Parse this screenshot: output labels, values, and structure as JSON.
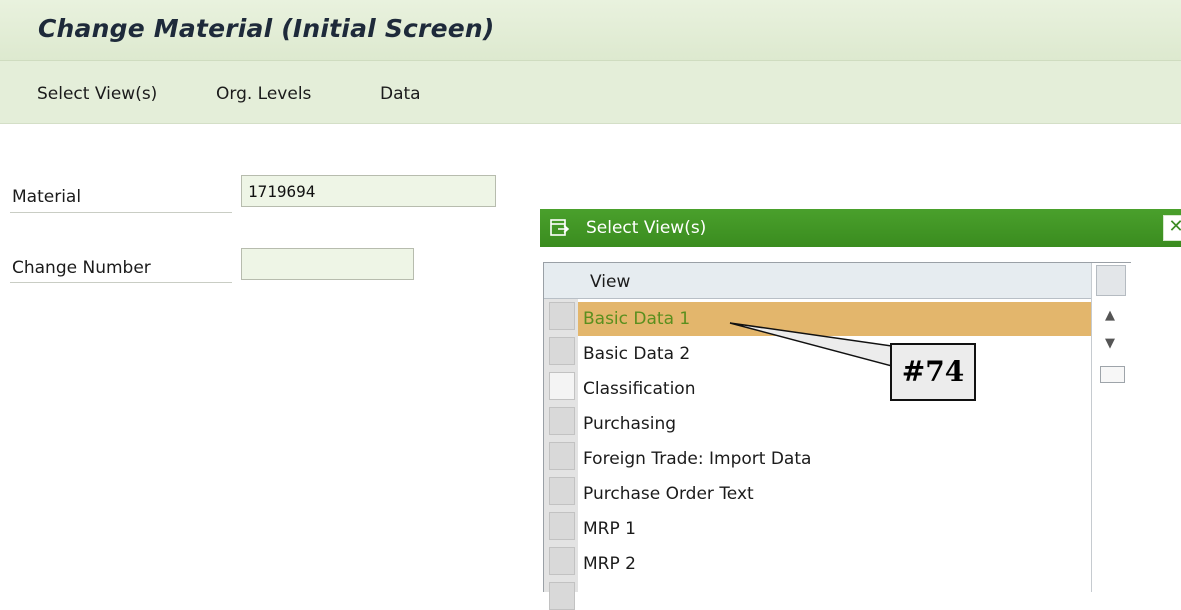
{
  "window": {
    "title": "Change Material (Initial Screen)"
  },
  "menu": {
    "items": [
      "Select View(s)",
      "Org. Levels",
      "Data"
    ]
  },
  "form": {
    "material": {
      "label": "Material",
      "value": "1719694"
    },
    "change_number": {
      "label": "Change Number",
      "value": ""
    }
  },
  "dialog": {
    "title": "Select View(s)",
    "close_icon": "close-icon",
    "column_header": "View",
    "rows": [
      {
        "label": "Basic Data 1",
        "selected": true
      },
      {
        "label": "Basic Data 2",
        "selected": false
      },
      {
        "label": "Classification",
        "selected": false
      },
      {
        "label": "Purchasing",
        "selected": false
      },
      {
        "label": "Foreign Trade: Import Data",
        "selected": false
      },
      {
        "label": "Purchase Order Text",
        "selected": false
      },
      {
        "label": "MRP 1",
        "selected": false
      },
      {
        "label": "MRP 2",
        "selected": false
      }
    ]
  },
  "callout": {
    "text": "#74"
  },
  "colors": {
    "titlebar_bg": "#e6f0db",
    "dialog_header": "#42962a",
    "selected_row": "#e3b66c",
    "selected_text": "#5a8f1e"
  }
}
